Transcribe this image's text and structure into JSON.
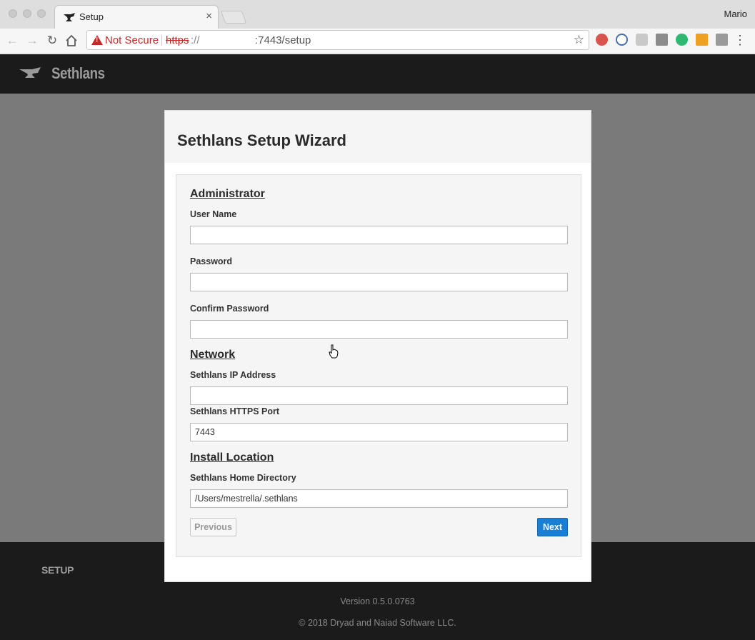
{
  "browser": {
    "tab_title": "Setup",
    "tab_close": "×",
    "profile_name": "Mario",
    "security_label": "Not Secure",
    "url_scheme": "https",
    "url_separator": "://",
    "url_rest": ":7443/setup",
    "star_icon": "☆",
    "menu_icon": "⋮"
  },
  "app": {
    "brand": "Sethlans",
    "title": "Sethlans Setup Wizard"
  },
  "form": {
    "administrator": {
      "heading": "Administrator",
      "username_label": "User Name",
      "username_value": "",
      "password_label": "Password",
      "password_value": "",
      "confirm_label": "Confirm Password",
      "confirm_value": ""
    },
    "network": {
      "heading": "Network",
      "ip_label": "Sethlans IP Address",
      "ip_value": "",
      "port_label": "Sethlans HTTPS Port",
      "port_value": "7443"
    },
    "install": {
      "heading": "Install Location",
      "home_label": "Sethlans Home Directory",
      "home_value": "/Users/mestrella/.sethlans"
    },
    "previous_label": "Previous",
    "next_label": "Next"
  },
  "footer": {
    "nav_label": "SETUP",
    "version": "Version 0.5.0.0763",
    "copyright": "© 2018 Dryad and Naiad Software LLC."
  },
  "colors": {
    "accent": "#1a7fd4",
    "header_bg": "#1b1b1b",
    "page_bg": "#7a7a7a",
    "warning": "#c62828"
  }
}
